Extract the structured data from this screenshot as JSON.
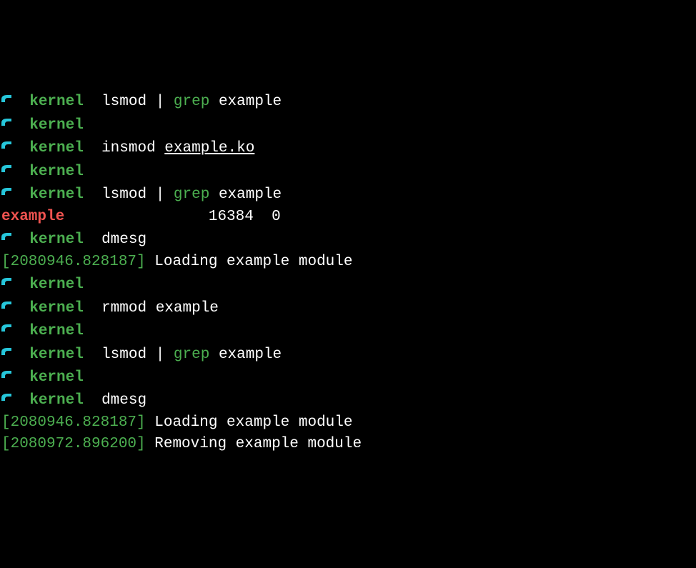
{
  "prompt": {
    "cwd": "kernel"
  },
  "lines": [
    {
      "type": "cmd",
      "parts": [
        {
          "t": "cmd",
          "v": "lsmod"
        },
        {
          "t": "space",
          "v": " "
        },
        {
          "t": "pipe",
          "v": "|"
        },
        {
          "t": "space",
          "v": " "
        },
        {
          "t": "grep",
          "v": "grep"
        },
        {
          "t": "space",
          "v": " "
        },
        {
          "t": "cmd",
          "v": "example"
        }
      ]
    },
    {
      "type": "cmd-empty"
    },
    {
      "type": "cmd",
      "parts": [
        {
          "t": "cmd",
          "v": "insmod"
        },
        {
          "t": "space",
          "v": " "
        },
        {
          "t": "underline",
          "v": "example.ko"
        }
      ]
    },
    {
      "type": "cmd-empty"
    },
    {
      "type": "cmd",
      "parts": [
        {
          "t": "cmd",
          "v": "lsmod"
        },
        {
          "t": "space",
          "v": " "
        },
        {
          "t": "pipe",
          "v": "|"
        },
        {
          "t": "space",
          "v": " "
        },
        {
          "t": "grep",
          "v": "grep"
        },
        {
          "t": "space",
          "v": " "
        },
        {
          "t": "cmd",
          "v": "example"
        }
      ]
    },
    {
      "type": "grep-output",
      "match": "example",
      "rest": "                16384  0"
    },
    {
      "type": "cmd",
      "parts": [
        {
          "t": "cmd",
          "v": "dmesg"
        }
      ]
    },
    {
      "type": "dmesg",
      "ts": "[2080946.828187]",
      "msg": " Loading example module"
    },
    {
      "type": "cmd-empty"
    },
    {
      "type": "cmd",
      "parts": [
        {
          "t": "cmd",
          "v": "rmmod"
        },
        {
          "t": "space",
          "v": " "
        },
        {
          "t": "cmd",
          "v": "example"
        }
      ]
    },
    {
      "type": "cmd-empty"
    },
    {
      "type": "cmd",
      "parts": [
        {
          "t": "cmd",
          "v": "lsmod"
        },
        {
          "t": "space",
          "v": " "
        },
        {
          "t": "pipe",
          "v": "|"
        },
        {
          "t": "space",
          "v": " "
        },
        {
          "t": "grep",
          "v": "grep"
        },
        {
          "t": "space",
          "v": " "
        },
        {
          "t": "cmd",
          "v": "example"
        }
      ]
    },
    {
      "type": "cmd-empty"
    },
    {
      "type": "cmd",
      "parts": [
        {
          "t": "cmd",
          "v": "dmesg"
        }
      ]
    },
    {
      "type": "dmesg",
      "ts": "[2080946.828187]",
      "msg": " Loading example module"
    },
    {
      "type": "dmesg",
      "ts": "[2080972.896200]",
      "msg": " Removing example module"
    }
  ]
}
